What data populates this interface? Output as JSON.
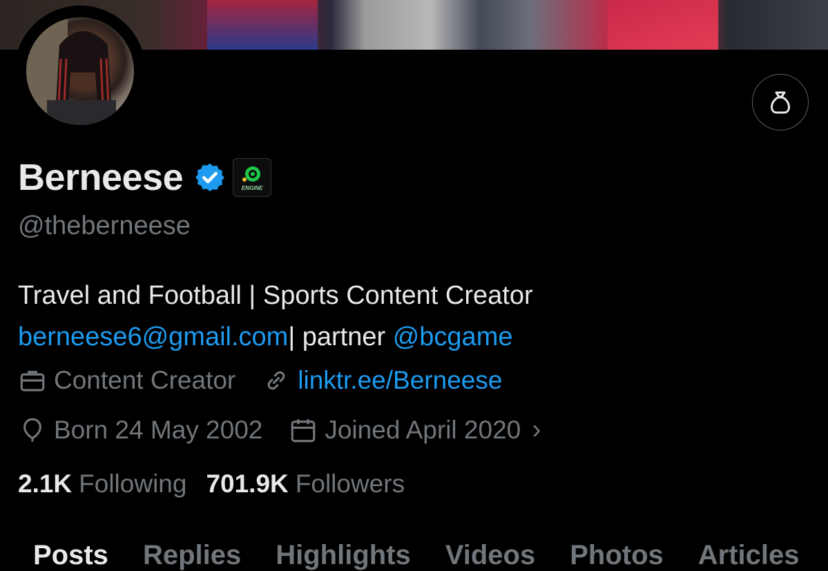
{
  "profile": {
    "name": "Berneese",
    "handle": "@theberneese",
    "affiliate_badge_text": "ENGINE",
    "bio_line1": "Travel and Football | Sports Content Creator",
    "bio_email": "berneese6@gmail.com",
    "bio_sep": "| partner ",
    "bio_mention": "@bcgame",
    "category": "Content Creator",
    "website": "linktr.ee/Berneese",
    "born": "Born 24 May 2002",
    "joined": "Joined April 2020",
    "joined_chevron": "›"
  },
  "stats": {
    "following_count": "2.1K",
    "following_label": "Following",
    "followers_count": "701.9K",
    "followers_label": "Followers"
  },
  "tabs": [
    {
      "label": "Posts",
      "active": true
    },
    {
      "label": "Replies",
      "active": false
    },
    {
      "label": "Highlights",
      "active": false
    },
    {
      "label": "Videos",
      "active": false
    },
    {
      "label": "Photos",
      "active": false
    },
    {
      "label": "Articles",
      "active": false
    }
  ],
  "colors": {
    "background": "#000000",
    "text_primary": "#e7e9ea",
    "text_secondary": "#71767b",
    "link": "#1d9bf0",
    "verified": "#1d9bf0"
  },
  "icons": {
    "action_button": "money-bag-icon",
    "verified": "verified-badge-icon",
    "category": "briefcase-icon",
    "website": "link-icon",
    "born": "balloon-icon",
    "joined": "calendar-icon"
  }
}
